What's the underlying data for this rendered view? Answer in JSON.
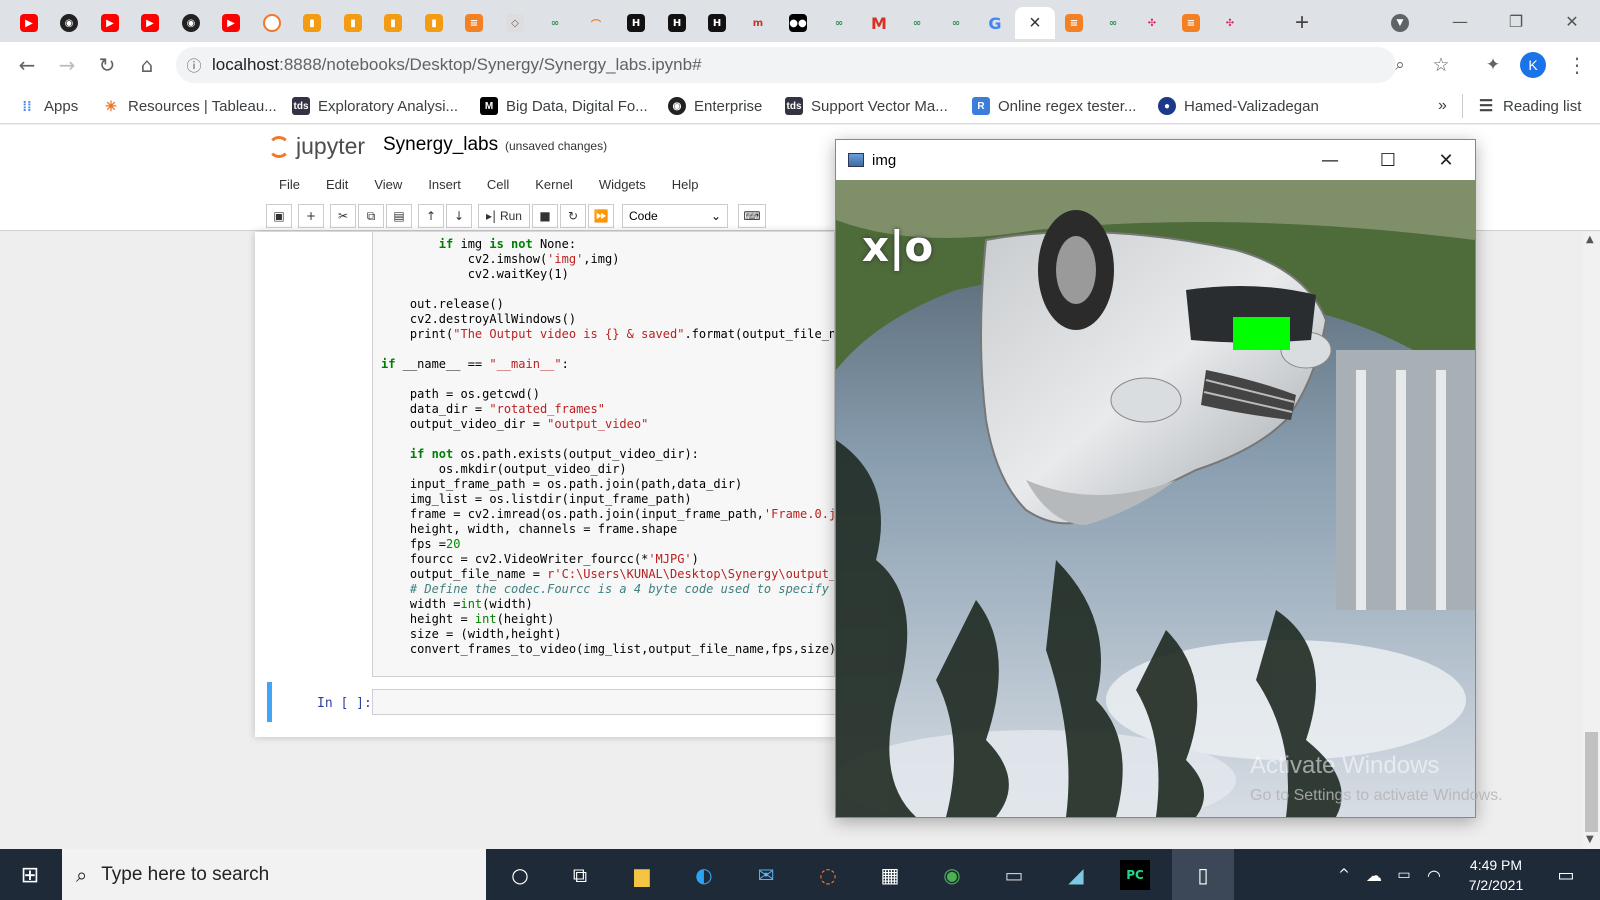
{
  "browser": {
    "tabs": [
      "youtube",
      "github",
      "youtube",
      "youtube",
      "github",
      "youtube",
      "jupyter",
      "book",
      "book",
      "book",
      "book",
      "stack",
      "paper",
      "leetcode",
      "bend",
      "hr",
      "hr",
      "hr",
      "hr-m",
      "medium",
      "leetcode",
      "gmail",
      "leetcode",
      "leetcode",
      "google",
      "active",
      "stack",
      "leetcode",
      "slack",
      "stack",
      "colab"
    ],
    "url_host": "localhost",
    "url_rest": ":8888/notebooks/Desktop/Synergy/Synergy_labs.ipynb#",
    "profile_initial": "K",
    "new_tab": "+",
    "active_close": "×"
  },
  "bookmarks": {
    "apps": "Apps",
    "items": [
      "Resources | Tableau...",
      "Exploratory Analysi...",
      "Big Data, Digital Fo...",
      "Enterprise",
      "Support Vector Ma...",
      "Online regex tester...",
      "Hamed-Valizadegan"
    ],
    "more": "»",
    "reading_list": "Reading list"
  },
  "jupyter": {
    "logo": "jupyter",
    "notebook_name": "Synergy_labs",
    "status": "(unsaved changes)",
    "menu": [
      "File",
      "Edit",
      "View",
      "Insert",
      "Cell",
      "Kernel",
      "Widgets",
      "Help"
    ],
    "run_label": "Run",
    "cell_type": "Code",
    "prompt": "In [ ]:"
  },
  "imgwin": {
    "title": "img",
    "overlay_text": "x|o"
  },
  "watermark": {
    "line1": "Activate Windows",
    "line2": "Go to Settings to activate Windows."
  },
  "taskbar": {
    "search_placeholder": "Type here to search",
    "time": "4:49 PM",
    "date": "7/2/2021"
  }
}
